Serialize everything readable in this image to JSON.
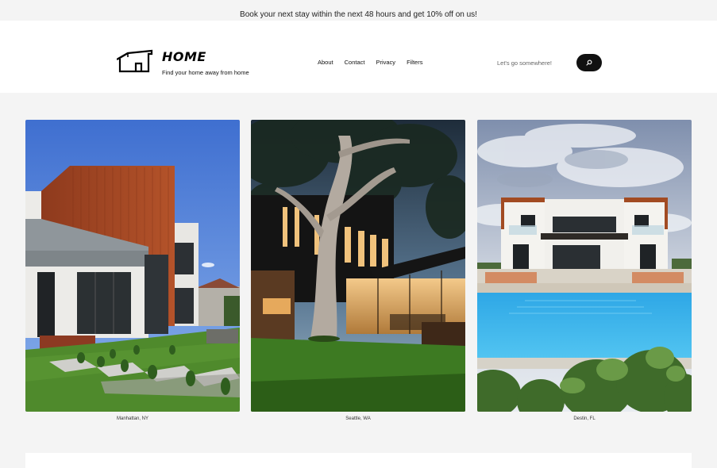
{
  "promo": {
    "text": "Book your next stay within the next 48 hours and get 10% off on us!"
  },
  "brand": {
    "title": "HOME",
    "subtitle": "Find your home away from home"
  },
  "nav": {
    "items": [
      "About",
      "Contact",
      "Privacy",
      "Filters"
    ]
  },
  "search": {
    "placeholder": "Let's go somewhere!",
    "button_icon": "search-icon"
  },
  "listings": [
    {
      "location": "Manhattan, NY"
    },
    {
      "location": "Seattle, WA"
    },
    {
      "location": "Destin, FL"
    }
  ],
  "colors": {
    "background": "#f4f4f4",
    "header_bg": "#ffffff",
    "button_bg": "#111111",
    "text": "#111111"
  }
}
